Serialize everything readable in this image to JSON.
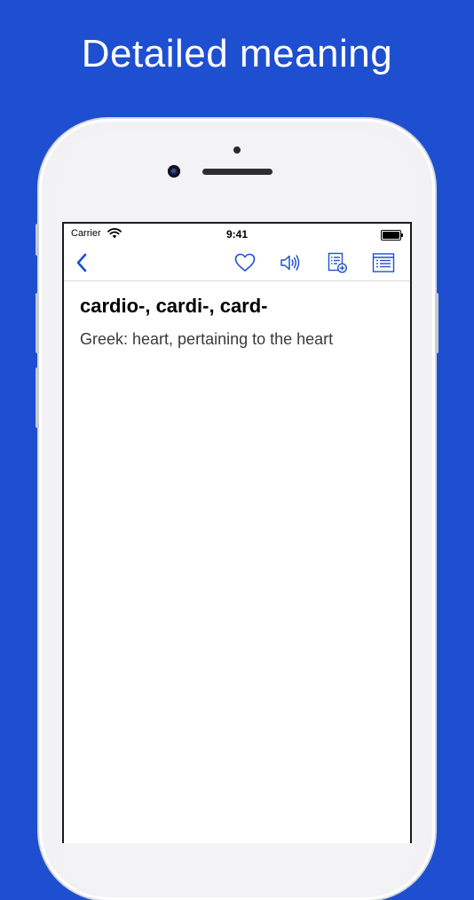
{
  "promo": {
    "headline": "Detailed meaning"
  },
  "status_bar": {
    "carrier": "Carrier",
    "time": "9:41",
    "battery_level": 1.0
  },
  "nav_bar": {
    "buttons": [
      {
        "name": "back",
        "icon": "chevron-left-icon"
      },
      {
        "name": "favorite",
        "icon": "heart-icon"
      },
      {
        "name": "pronounce",
        "icon": "speaker-icon"
      },
      {
        "name": "add-to-list",
        "icon": "list-add-icon"
      },
      {
        "name": "word-list",
        "icon": "list-icon"
      }
    ]
  },
  "entry": {
    "term": "cardio-, cardi-, card-",
    "definition": "Greek: heart, pertaining to the heart"
  },
  "colors": {
    "background": "#1f4fd1",
    "accent": "#1f4fd1",
    "text": "#000000"
  }
}
